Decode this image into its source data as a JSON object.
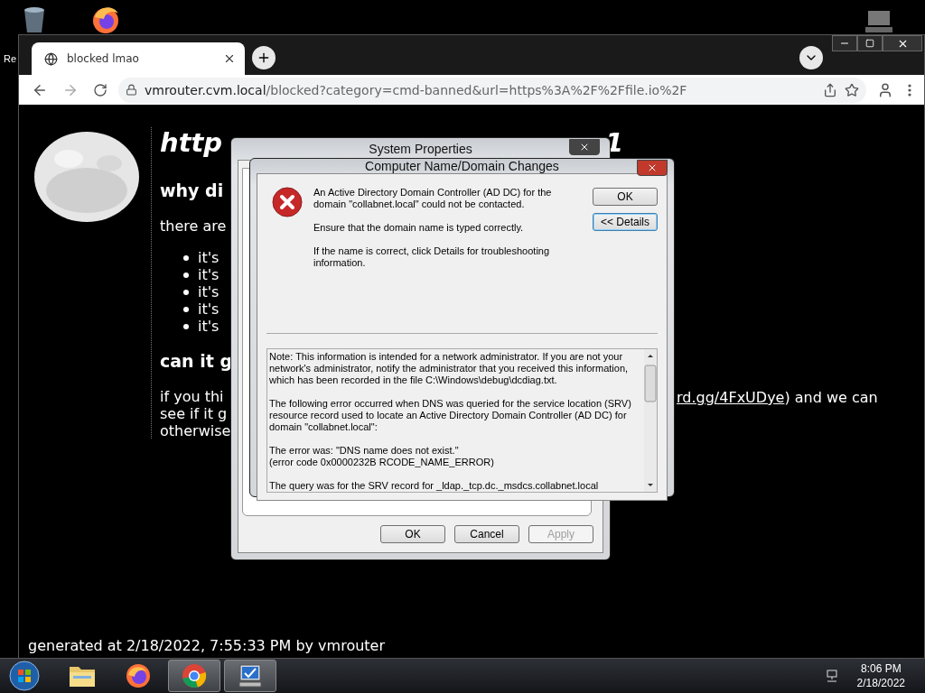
{
  "desktop": {
    "icon_label": "Re"
  },
  "browser": {
    "tab_title": "blocked lmao",
    "url_host": "vmrouter.cvm.local",
    "url_path": "/blocked?category=cmd-banned&url=https%3A%2F%2Ffile.io%2F"
  },
  "page": {
    "heading_start": "http",
    "heading_end": "1",
    "subheading_1": "why di",
    "intro": "there are",
    "bullets": [
      "it's",
      "it's",
      "it's",
      "it's",
      "it's"
    ],
    "subheading_2": "can it g",
    "para_lines": [
      "if you thi",
      "see if it g",
      "otherwise"
    ],
    "link": "rd.gg/4FxUDye",
    "link_tail": ") and we can",
    "footer": "generated at 2/18/2022, 7:55:33 PM by vmrouter"
  },
  "system_properties": {
    "title": "System Properties",
    "buttons": [
      {
        "label": "OK",
        "disabled": false
      },
      {
        "label": "Cancel",
        "disabled": false
      },
      {
        "label": "Apply",
        "disabled": true
      }
    ]
  },
  "domain_dialog": {
    "title": "Computer Name/Domain Changes",
    "message": [
      "An Active Directory Domain Controller (AD DC) for the domain \"collabnet.local\" could not be contacted.",
      "Ensure that the domain name is typed correctly.",
      "If the name is correct, click Details for troubleshooting information."
    ],
    "buttons": [
      {
        "label": "OK",
        "focused": false
      },
      {
        "label": "<< Details",
        "focused": true
      }
    ],
    "details": [
      [
        "Note: This information is intended for a network administrator.  If you are not your network's administrator, notify the administrator that you received this information, which has been recorded in the file C:\\Windows\\debug\\dcdiag.txt."
      ],
      [
        "The following error occurred when DNS was queried for the service location (SRV) resource record used to locate an Active Directory Domain Controller (AD DC) for domain \"collabnet.local\":"
      ],
      [
        "The error was: \"DNS name does not exist.\"",
        "(error code 0x0000232B RCODE_NAME_ERROR)"
      ],
      [
        "The query was for the SRV record for _ldap._tcp.dc._msdcs.collabnet.local"
      ]
    ]
  },
  "taskbar": {
    "apps": [
      {
        "kind": "explorer",
        "highlighted": false
      },
      {
        "kind": "firefox",
        "highlighted": false
      },
      {
        "kind": "chrome",
        "highlighted": true
      },
      {
        "kind": "system",
        "highlighted": true
      }
    ],
    "time": "8:06 PM",
    "date": "2/18/2022"
  }
}
